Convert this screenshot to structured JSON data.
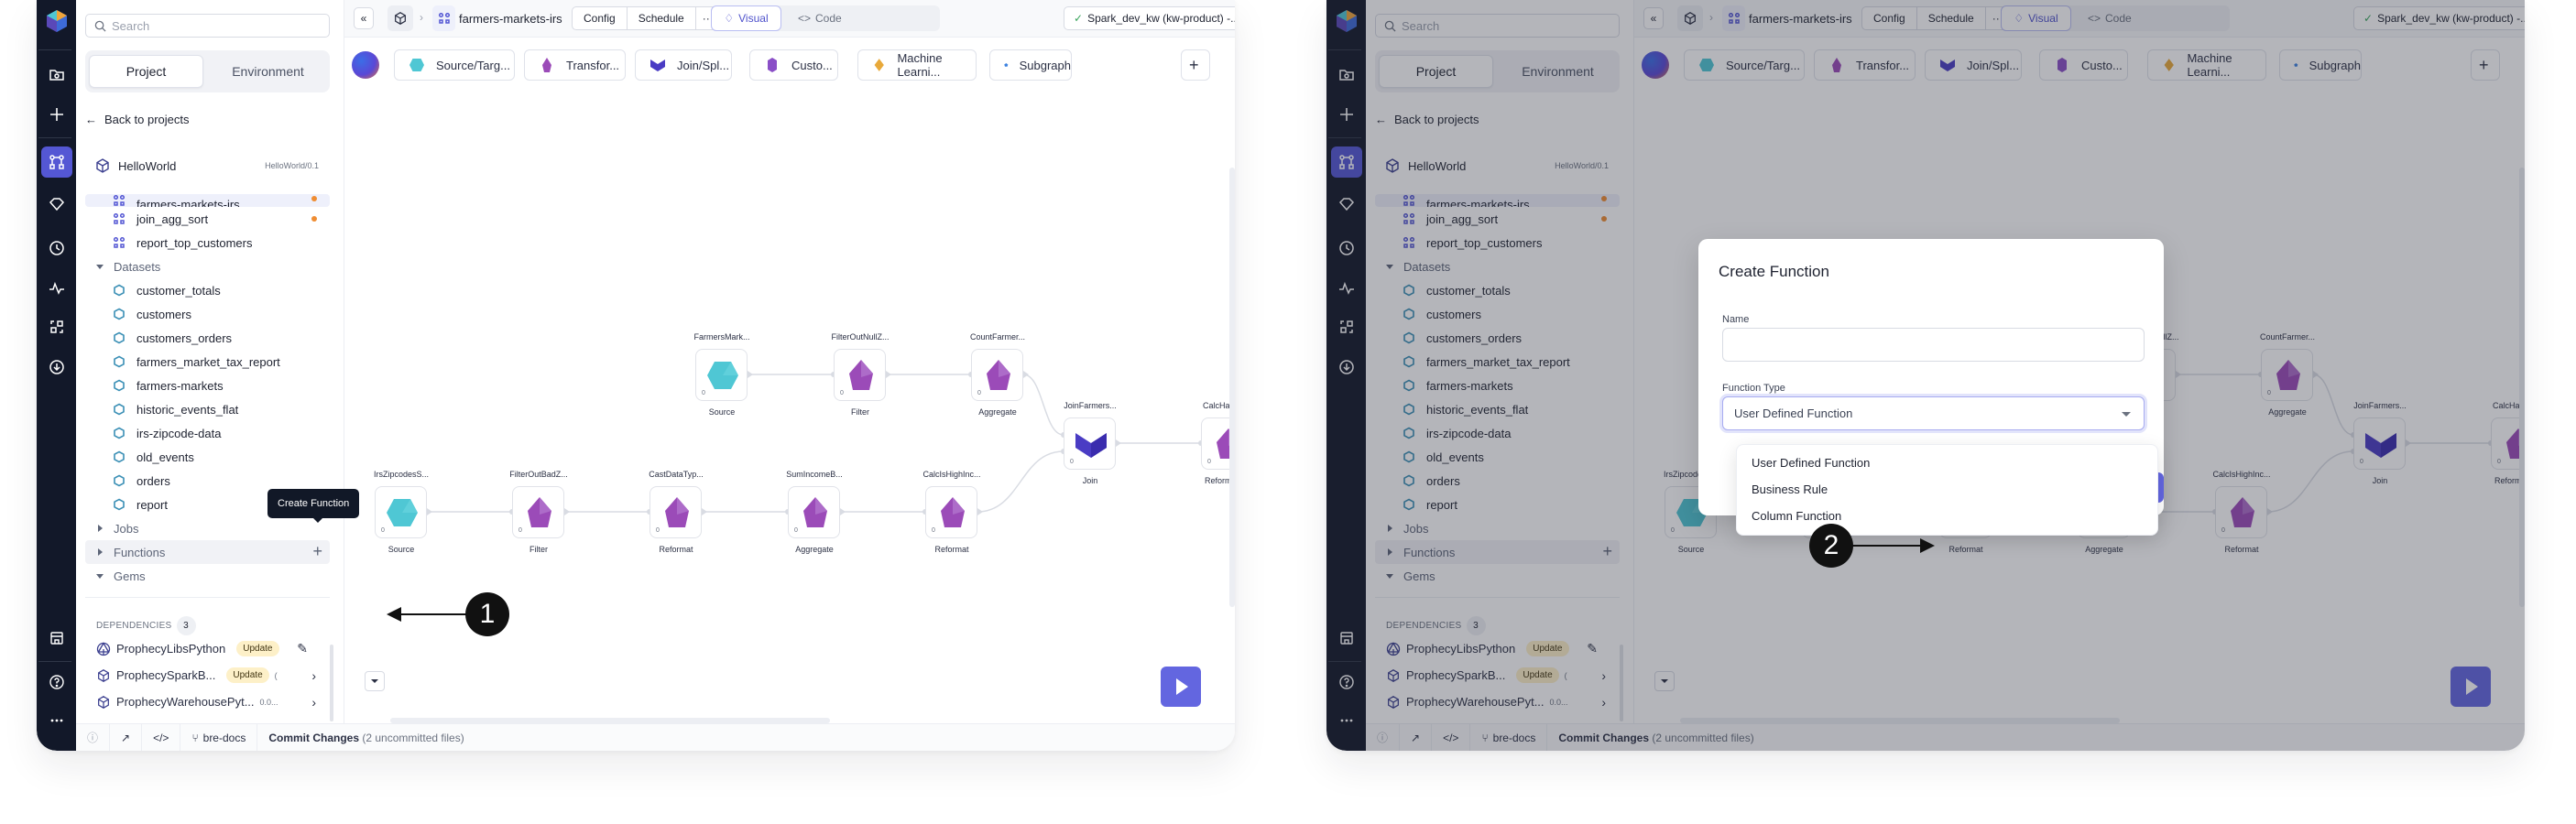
{
  "colors": {
    "rail": "#121829",
    "accent": "#5457d4",
    "run_button": "#6366e0",
    "source_gem": "#4fc7d4",
    "transform_gem": "#9b4bb8",
    "join_gem": "#4a3cc4",
    "ml_gem": "#e8a93a",
    "subgraph_gem": "#3d82e0",
    "modified_dot": "#ef8d33",
    "update_badge": "#fdf0c8"
  },
  "sidebar": {
    "search_placeholder": "Search",
    "tabs": [
      {
        "label": "Project",
        "selected": true
      },
      {
        "label": "Environment",
        "selected": false
      }
    ],
    "back_label": "Back to projects",
    "project": {
      "name": "HelloWorld",
      "version": "HelloWorld/0.1"
    },
    "pipelines": [
      {
        "name": "farmers-markets-irs",
        "modified": true,
        "active": true
      },
      {
        "name": "join_agg_sort",
        "modified": true
      },
      {
        "name": "report_top_customers",
        "modified": false
      }
    ],
    "groups": {
      "datasets": "Datasets",
      "jobs": "Jobs",
      "functions": "Functions",
      "gems": "Gems"
    },
    "datasets": [
      "customer_totals",
      "customers",
      "customers_orders",
      "farmers_market_tax_report",
      "farmers-markets",
      "historic_events_flat",
      "irs-zipcode-data",
      "old_events",
      "orders",
      "report"
    ],
    "dependencies": {
      "title": "DEPENDENCIES",
      "count": "3",
      "items": [
        {
          "name": "ProphecyLibsPython",
          "badge": "Update",
          "version": "",
          "action": "edit-icon"
        },
        {
          "name": "ProphecySparkB...",
          "badge": "Update",
          "version": "(",
          "action": "chevron-right-icon"
        },
        {
          "name": "ProphecyWarehousePyt...",
          "badge": "",
          "version": "0.0...",
          "action": "chevron-right-icon"
        }
      ]
    }
  },
  "header": {
    "pipeline_name": "farmers-markets-irs",
    "buttons": {
      "config": "Config",
      "schedule": "Schedule",
      "more": "···"
    },
    "view_toggle": {
      "visual": "Visual",
      "code": "Code"
    },
    "fabric": "Spark_dev_kw (kw-product)  -..."
  },
  "gem_bar": [
    {
      "label": "Source/Targ...",
      "icon": "hexagon"
    },
    {
      "label": "Transfor...",
      "icon": "pentagon"
    },
    {
      "label": "Join/Spl...",
      "icon": "chevron"
    },
    {
      "label": "Custo...",
      "icon": "hexagon-tall"
    },
    {
      "label": "Machine Learni...",
      "icon": "diamond"
    },
    {
      "label": "Subgraph",
      "icon": "pentagon-blue"
    }
  ],
  "canvas": {
    "nodes": [
      {
        "id": "n1",
        "title": "FarmersMark...",
        "type": "Source",
        "count": "0"
      },
      {
        "id": "n2",
        "title": "FilterOutNullZ...",
        "type": "Filter",
        "count": "0"
      },
      {
        "id": "n3",
        "title": "CountFarmer...",
        "type": "Aggregate",
        "count": "0"
      },
      {
        "id": "n4",
        "title": "IrsZipcodesS...",
        "type": "Source",
        "count": "0"
      },
      {
        "id": "n5",
        "title": "FilterOutBadZ...",
        "type": "Filter",
        "count": "0"
      },
      {
        "id": "n6",
        "title": "CastDataTyp...",
        "type": "Reformat",
        "count": "0"
      },
      {
        "id": "n7",
        "title": "SumIncomeB...",
        "type": "Aggregate",
        "count": "0"
      },
      {
        "id": "n8",
        "title": "CalcIsHighInc...",
        "type": "Reformat",
        "count": "0"
      },
      {
        "id": "n9",
        "title": "JoinFarmers...",
        "type": "Join",
        "count": "0"
      },
      {
        "id": "n10",
        "title": "CalcHas",
        "type": "Reform",
        "count": "0"
      }
    ]
  },
  "status_bar": {
    "branch": "bre-docs",
    "commit_label": "Commit Changes",
    "commit_meta": "(2 uncommitted files)"
  },
  "tooltip": "Create Function",
  "callouts": [
    "1",
    "2"
  ],
  "modal": {
    "title": "Create Function",
    "name_label": "Name",
    "name_value": "",
    "type_label": "Function Type",
    "type_value": "User Defined Function",
    "options": [
      "User Defined Function",
      "Business Rule",
      "Column Function"
    ]
  }
}
